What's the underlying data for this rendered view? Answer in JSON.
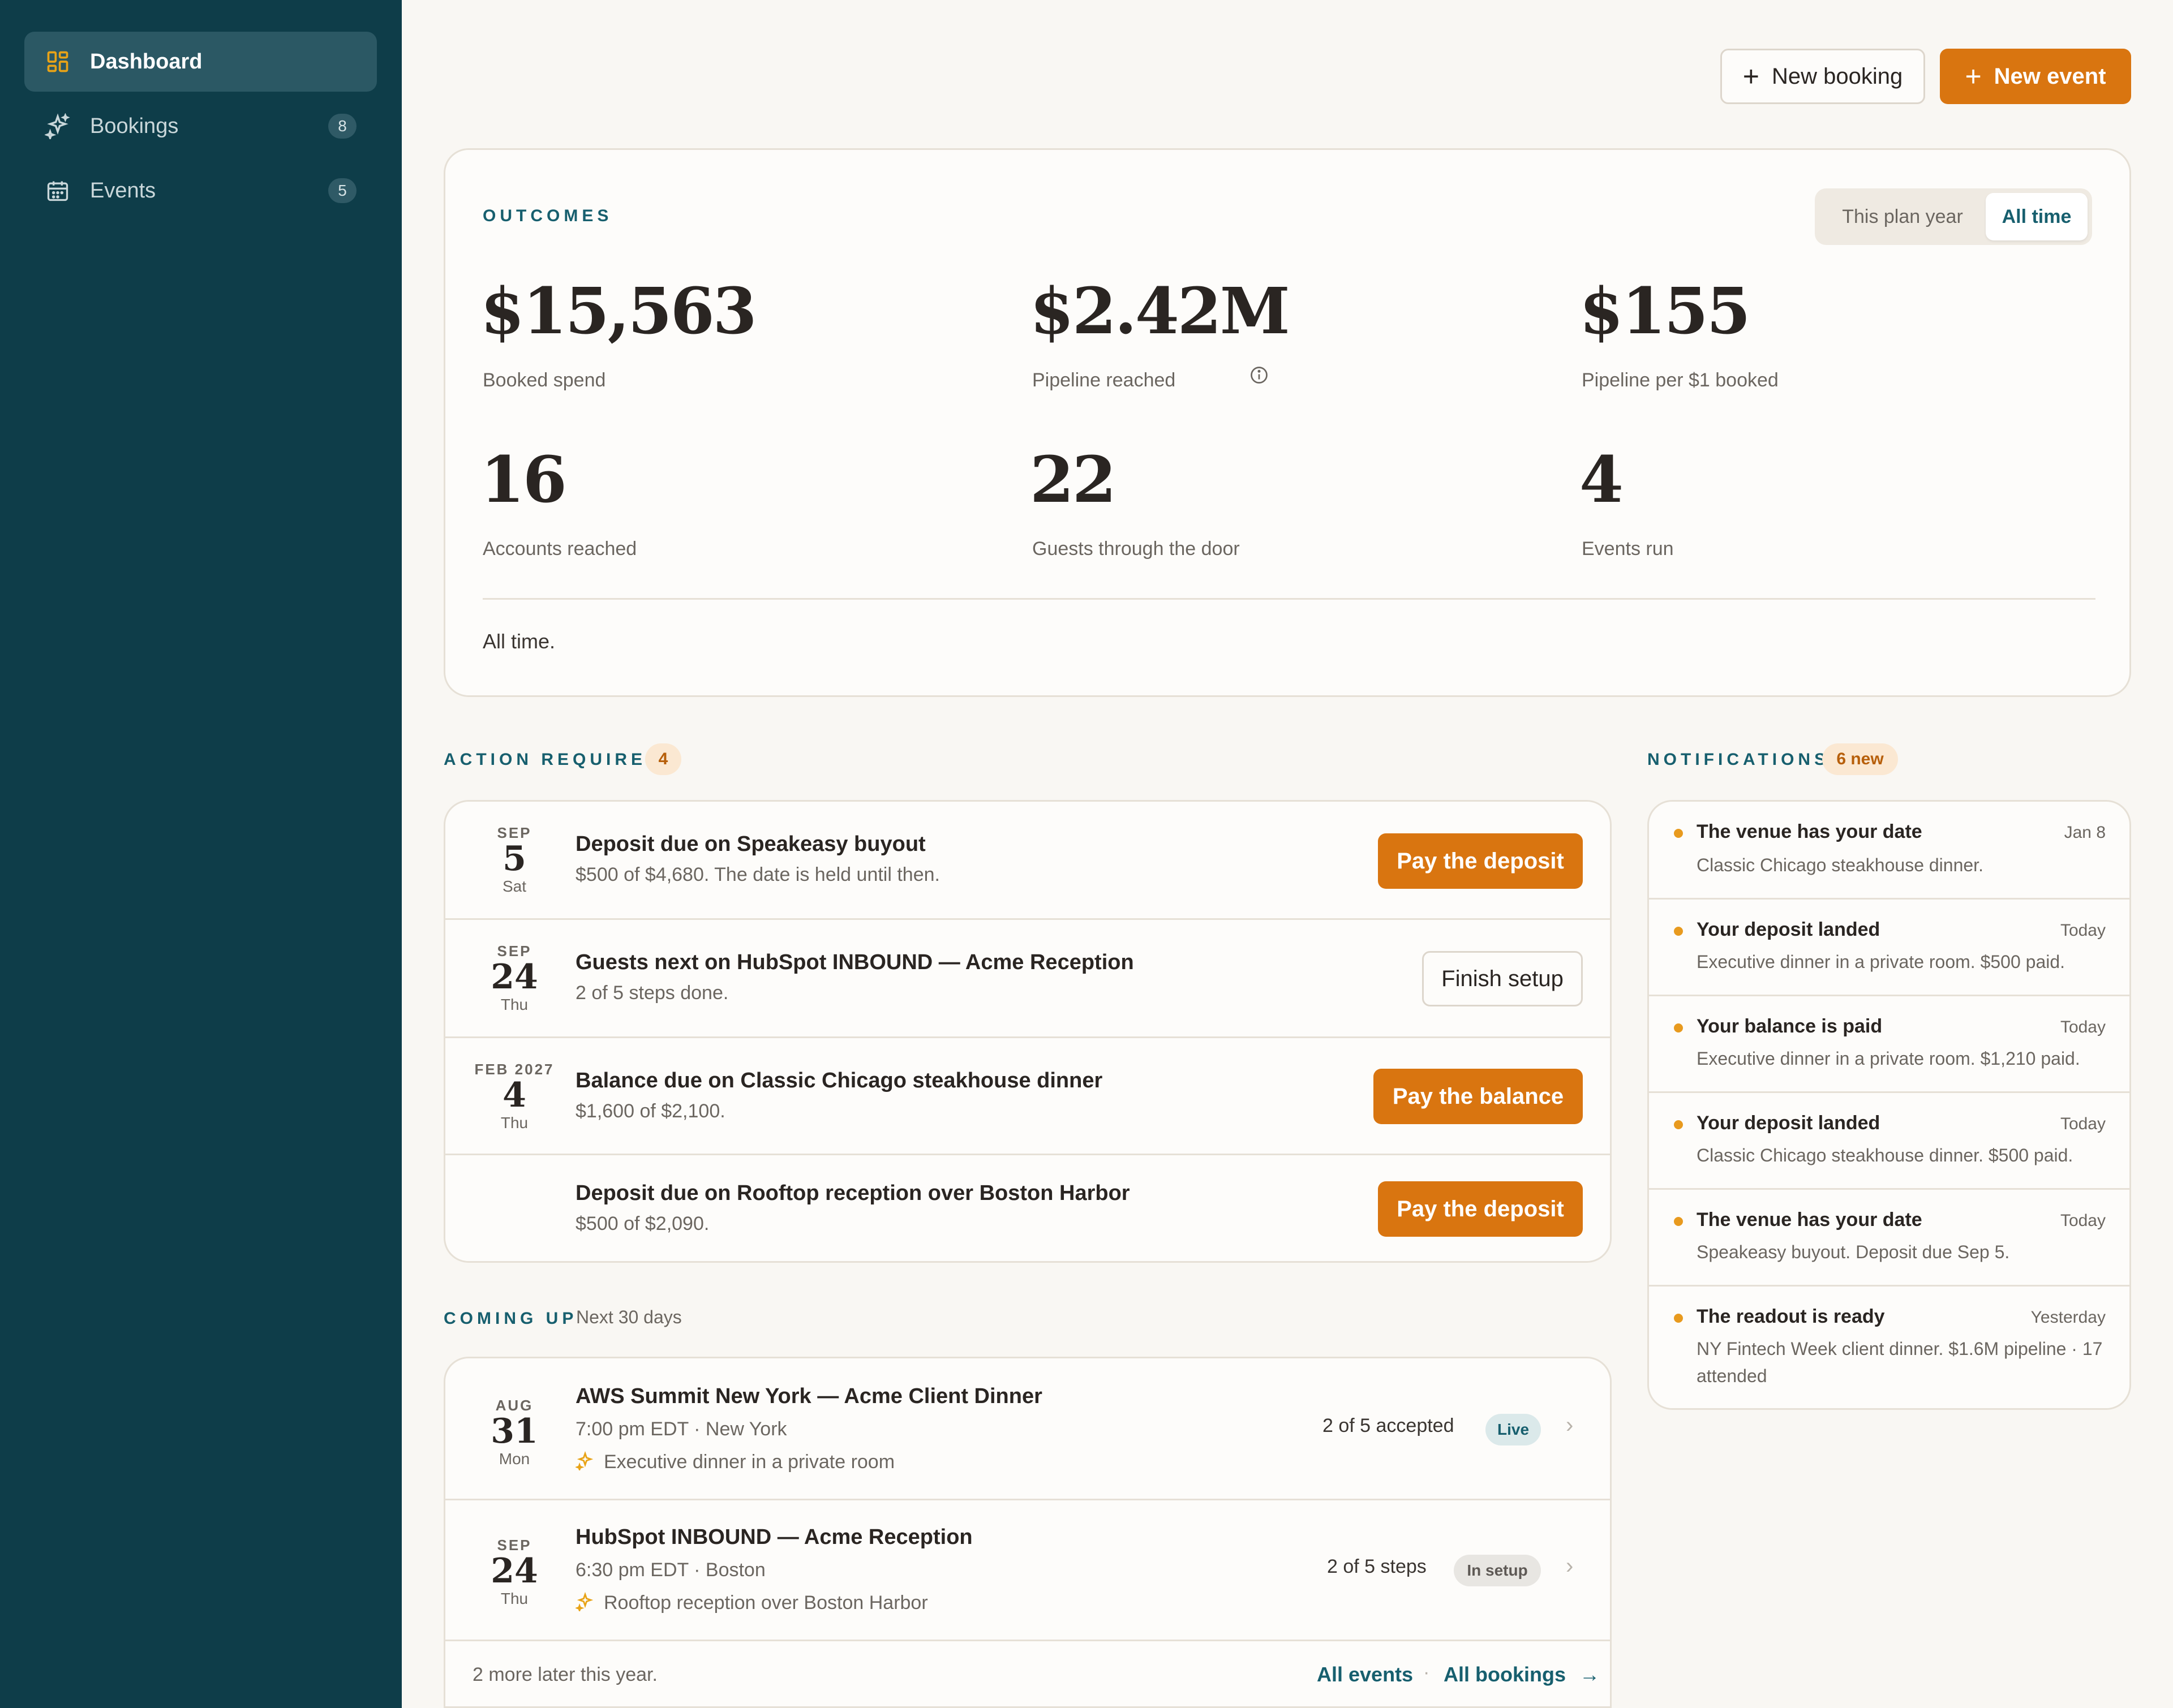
{
  "sidebar": {
    "items": [
      {
        "label": "Dashboard",
        "icon": "dashboard-icon",
        "count": ""
      },
      {
        "label": "Bookings",
        "icon": "sparkle-icon",
        "count": "8"
      },
      {
        "label": "Events",
        "icon": "calendar-icon",
        "count": "5"
      }
    ]
  },
  "header": {
    "new_booking": "New booking",
    "new_event": "New event"
  },
  "outcomes": {
    "title": "OUTCOMES",
    "toggle": {
      "plan_year": "This plan year",
      "all_time": "All time",
      "selected": "All time"
    },
    "metrics": [
      {
        "value": "$15,563",
        "label": "Booked spend"
      },
      {
        "value": "$2.42M",
        "label": "Pipeline reached"
      },
      {
        "value": "$155",
        "label": "Pipeline per $1 booked"
      },
      {
        "value": "16",
        "label": "Accounts reached"
      },
      {
        "value": "22",
        "label": "Guests through the door"
      },
      {
        "value": "4",
        "label": "Events run"
      }
    ],
    "footer": "All time."
  },
  "action_required": {
    "title": "ACTION REQUIRED",
    "count": "4",
    "items": [
      {
        "month": "SEP",
        "day": "5",
        "dow": "Sat",
        "title": "Deposit due on Speakeasy buyout",
        "subtitle": "$500 of $4,680. The date is held until then.",
        "button": "Pay the deposit"
      },
      {
        "month": "SEP",
        "day": "24",
        "dow": "Thu",
        "title": "Guests next on HubSpot INBOUND — Acme Reception",
        "subtitle": "2 of 5 steps done.",
        "button": "Finish setup"
      },
      {
        "month": "FEB 2027",
        "day": "4",
        "dow": "Thu",
        "title": "Balance due on Classic Chicago steakhouse dinner",
        "subtitle": "$1,600 of $2,100.",
        "button": "Pay the balance"
      },
      {
        "month": "",
        "day": "",
        "dow": "",
        "title": "Deposit due on Rooftop reception over Boston Harbor",
        "subtitle": "$500 of $2,090.",
        "button": "Pay the deposit"
      }
    ]
  },
  "coming_up": {
    "title": "COMING UP",
    "range": "Next 30 days",
    "items": [
      {
        "month": "AUG",
        "day": "31",
        "dow": "Mon",
        "title": "AWS Summit New York — Acme Client Dinner",
        "time": "7:00 pm EDT · New York",
        "venue": "Executive dinner in a private room",
        "progress": "2 of 5 accepted",
        "status": "Live"
      },
      {
        "month": "SEP",
        "day": "24",
        "dow": "Thu",
        "title": "HubSpot INBOUND — Acme Reception",
        "time": "6:30 pm EDT · Boston",
        "venue": "Rooftop reception over Boston Harbor",
        "progress": "2 of 5 steps",
        "status": "In setup"
      }
    ],
    "footer_text": "2 more later this year.",
    "all_events": "All events",
    "all_bookings": "All bookings"
  },
  "notifications": {
    "title": "NOTIFICATIONS",
    "badge": "6 new",
    "items": [
      {
        "title": "The venue has your date",
        "time": "Jan 8",
        "body": "Classic Chicago steakhouse dinner."
      },
      {
        "title": "Your deposit landed",
        "time": "Today",
        "body": "Executive dinner in a private room. $500 paid."
      },
      {
        "title": "Your balance is paid",
        "time": "Today",
        "body": "Executive dinner in a private room. $1,210 paid."
      },
      {
        "title": "Your deposit landed",
        "time": "Today",
        "body": "Classic Chicago steakhouse dinner. $500 paid."
      },
      {
        "title": "The venue has your date",
        "time": "Today",
        "body": "Speakeasy buyout. Deposit due Sep 5."
      },
      {
        "title": "The readout is ready",
        "time": "Yesterday",
        "body": "NY Fintech Week client dinner. $1.6M pipeline · 17 attended"
      }
    ]
  },
  "colors": {
    "sidebar_bg": "#0e3d49",
    "accent_orange": "#d97510",
    "accent_teal": "#175f6e",
    "page_bg": "#f9f7f3"
  }
}
